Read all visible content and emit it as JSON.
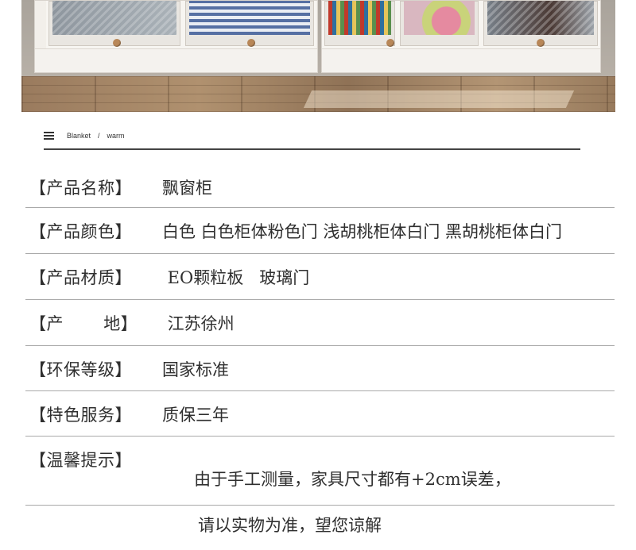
{
  "header": {
    "menu_icon": "hamburger-menu-icon",
    "breadcrumb": [
      "Blanket",
      "warm"
    ],
    "separator": "/"
  },
  "specs": [
    {
      "label": "【产品名称】",
      "value": "飘窗柜"
    },
    {
      "label": "【产品颜色】",
      "value": "白色 白色柜体粉色门 浅胡桃柜体白门 黑胡桃柜体白门"
    },
    {
      "label": "【产品材质】",
      "value": " EO颗粒板   玻璃门"
    },
    {
      "label": "【产       地】",
      "value": " 江苏徐州"
    },
    {
      "label": "【环保等级】",
      "value": "国家标准"
    },
    {
      "label": "【特色服务】",
      "value": "质保三年"
    },
    {
      "label": "【温馨提示】",
      "value": "由于手工测量，家具尺寸都有+2cm误差，",
      "value_line2": "请以实物为准，望您谅解"
    }
  ],
  "colors": {
    "text": "#2f2f2f",
    "divider": "#a9a9a9",
    "header_rule": "#444444"
  }
}
